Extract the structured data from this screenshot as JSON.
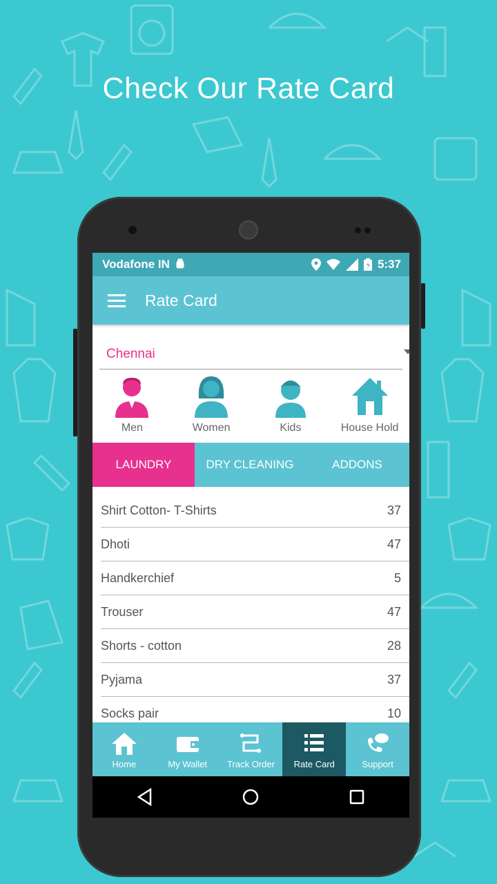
{
  "headline": "Check Our Rate Card",
  "status_bar": {
    "carrier": "Vodafone IN",
    "time": "5:37"
  },
  "app_bar": {
    "title": "Rate Card",
    "menu_icon": "hamburger-menu-icon"
  },
  "city": {
    "selected": "Chennai"
  },
  "categories": [
    {
      "label": "Men",
      "icon": "man-icon",
      "color": "#e8308f"
    },
    {
      "label": "Women",
      "icon": "woman-icon",
      "color": "#3fb4c4"
    },
    {
      "label": "Kids",
      "icon": "kid-icon",
      "color": "#3fb4c4"
    },
    {
      "label": "House Hold",
      "icon": "house-icon",
      "color": "#3fb4c4"
    }
  ],
  "tabs": [
    {
      "label": "LAUNDRY",
      "active": true
    },
    {
      "label": "DRY CLEANING",
      "active": false
    },
    {
      "label": "ADDONS",
      "active": false
    }
  ],
  "rates": [
    {
      "item": "Shirt Cotton- T-Shirts",
      "price": "37"
    },
    {
      "item": "Dhoti",
      "price": "47"
    },
    {
      "item": "Handkerchief",
      "price": "5"
    },
    {
      "item": "Trouser",
      "price": "47"
    },
    {
      "item": "Shorts - cotton",
      "price": "28"
    },
    {
      "item": "Pyjama",
      "price": "37"
    },
    {
      "item": "Socks pair",
      "price": "10"
    }
  ],
  "bottom_nav": [
    {
      "label": "Home",
      "icon": "home-icon"
    },
    {
      "label": "My Wallet",
      "icon": "wallet-icon"
    },
    {
      "label": "Track Order",
      "icon": "route-icon"
    },
    {
      "label": "Rate Card",
      "icon": "list-icon",
      "active": true
    },
    {
      "label": "Support",
      "icon": "support-chat-icon"
    }
  ],
  "colors": {
    "background": "#3cc8d0",
    "primary": "#5cc3d2",
    "accent": "#e8308f",
    "nav_active": "#1d5963"
  }
}
